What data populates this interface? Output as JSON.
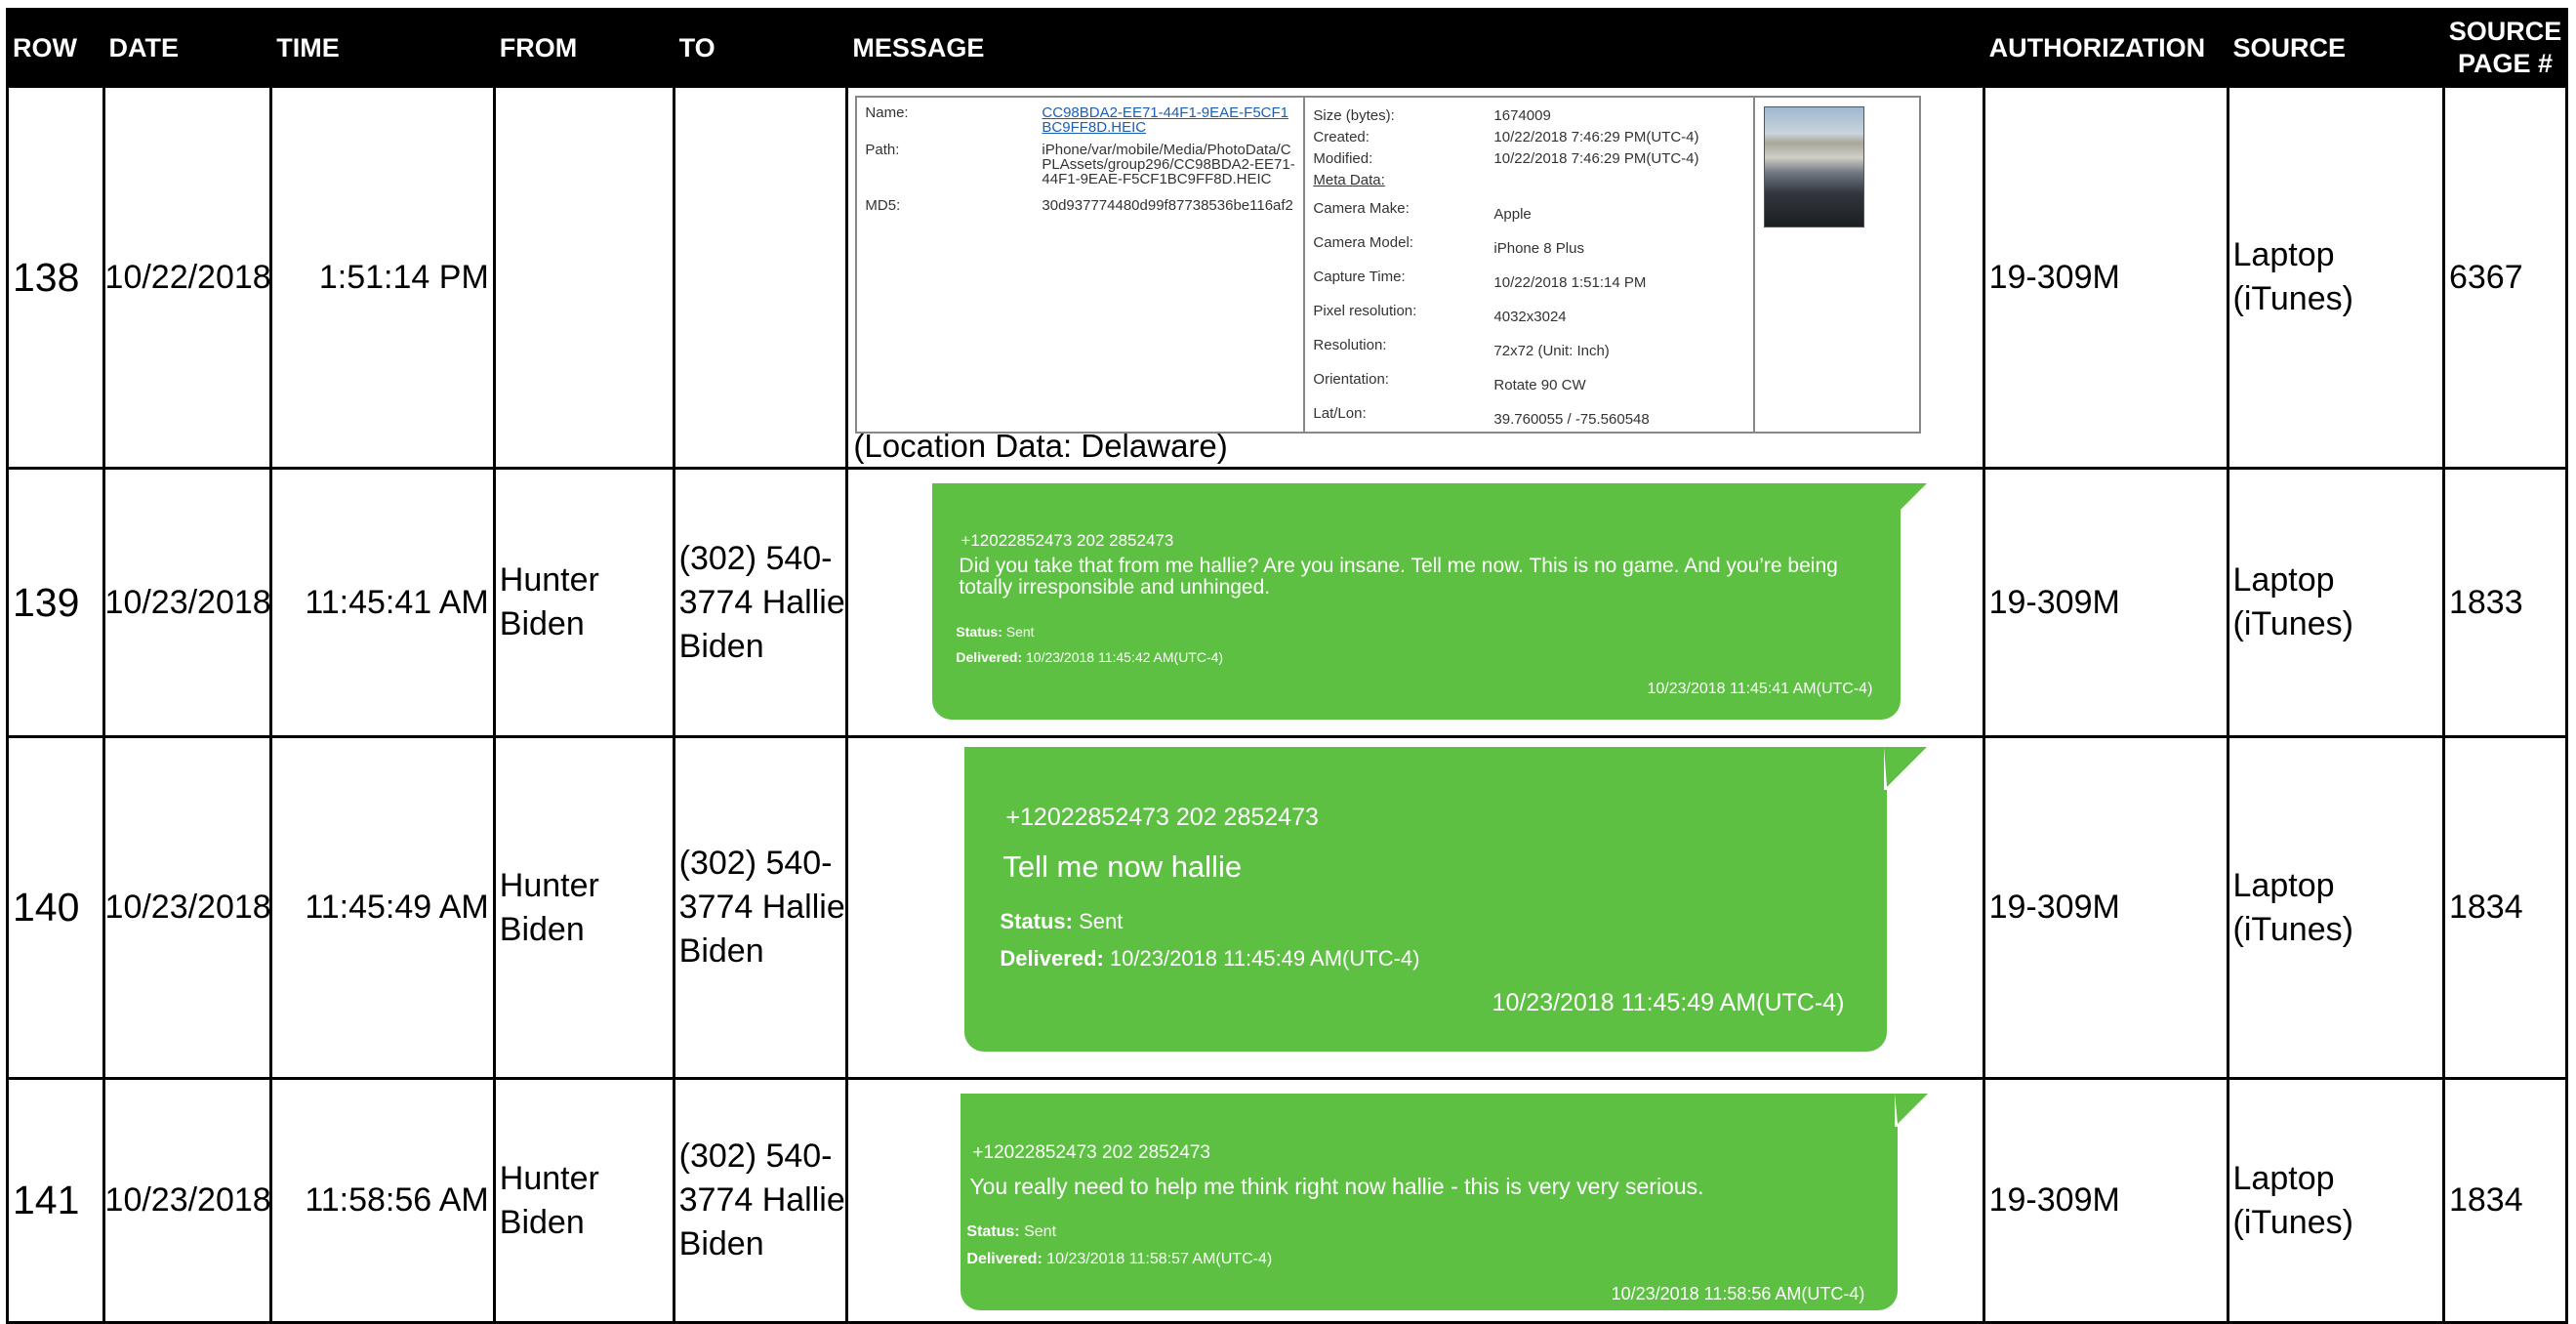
{
  "columns": [
    "ROW",
    "DATE",
    "TIME",
    "FROM",
    "TO",
    "MESSAGE",
    "AUTHORIZATION",
    "SOURCE",
    "SOURCE PAGE #"
  ],
  "rows": [
    {
      "row": "138",
      "date": "10/22/2018",
      "time": "1:51:14 PM",
      "from": "",
      "to": "",
      "authorization": "19-309M",
      "source": "Laptop (iTunes)",
      "page": "6367",
      "attachment": {
        "name_label": "Name:",
        "name_value": "CC98BDA2-EE71-44F1-9EAE-F5CF1BC9FF8D.HEIC",
        "path_label": "Path:",
        "path_value": "iPhone/var/mobile/Media/PhotoData/CPLAssets/group296/CC98BDA2-EE71-44F1-9EAE-F5CF1BC9FF8D.HEIC",
        "md5_label": "MD5:",
        "md5_value": "30d937774480d99f87738536be116af2",
        "size_label": "Size (bytes):",
        "size_value": "1674009",
        "created_label": "Created:",
        "created_value": "10/22/2018 7:46:29 PM(UTC-4)",
        "modified_label": "Modified:",
        "modified_value": "10/22/2018 7:46:29 PM(UTC-4)",
        "metadata_label": "Meta Data:",
        "camera_make_label": "Camera Make:",
        "camera_make_value": "Apple",
        "camera_model_label": "Camera Model:",
        "camera_model_value": "iPhone 8 Plus",
        "capture_time_label": "Capture Time:",
        "capture_time_value": "10/22/2018 1:51:14 PM",
        "pixel_res_label": "Pixel resolution:",
        "pixel_res_value": "4032x3024",
        "resolution_label": "Resolution:",
        "resolution_value": "72x72 (Unit: Inch)",
        "orientation_label": "Orientation:",
        "orientation_value": "Rotate 90 CW",
        "latlon_label": "Lat/Lon:",
        "latlon_value": "39.760055 / -75.560548"
      },
      "location_note": "(Location Data: Delaware)"
    },
    {
      "row": "139",
      "date": "10/23/2018",
      "time": "11:45:41 AM",
      "from": "Hunter Biden",
      "to": "(302) 540-3774 Hallie Biden",
      "authorization": "19-309M",
      "source": "Laptop (iTunes)",
      "page": "1833",
      "bubble": {
        "from_line": "+12022852473 202 2852473",
        "text": "Did you take that from me hallie? Are you insane. Tell me now. This is no game. And you’re being totally irresponsible and unhinged.",
        "status_label": "Status:",
        "status_value": "Sent",
        "delivered_label": "Delivered:",
        "delivered_value": "10/23/2018 11:45:42 AM(UTC-4)",
        "timestamp": "10/23/2018 11:45:41 AM(UTC-4)"
      }
    },
    {
      "row": "140",
      "date": "10/23/2018",
      "time": "11:45:49 AM",
      "from": "Hunter Biden",
      "to": "(302) 540-3774 Hallie Biden",
      "authorization": "19-309M",
      "source": "Laptop (iTunes)",
      "page": "1834",
      "bubble": {
        "from_line": "+12022852473 202 2852473",
        "text": "Tell me now hallie",
        "status_label": "Status:",
        "status_value": "Sent",
        "delivered_label": "Delivered:",
        "delivered_value": "10/23/2018 11:45:49 AM(UTC-4)",
        "timestamp": "10/23/2018 11:45:49 AM(UTC-4)"
      }
    },
    {
      "row": "141",
      "date": "10/23/2018",
      "time": "11:58:56 AM",
      "from": "Hunter Biden",
      "to": "(302) 540-3774 Hallie Biden",
      "authorization": "19-309M",
      "source": "Laptop (iTunes)",
      "page": "1834",
      "bubble": {
        "from_line": "+12022852473 202 2852473",
        "text": "You really need to help me think right now hallie - this is very very serious.",
        "status_label": "Status:",
        "status_value": "Sent",
        "delivered_label": "Delivered:",
        "delivered_value": "10/23/2018 11:58:57 AM(UTC-4)",
        "timestamp": "10/23/2018 11:58:56 AM(UTC-4)"
      }
    }
  ],
  "colors": {
    "header_bg": "#000000",
    "header_text": "#ffffff",
    "bubble": "#5dc042",
    "link": "#1a5fb4"
  }
}
